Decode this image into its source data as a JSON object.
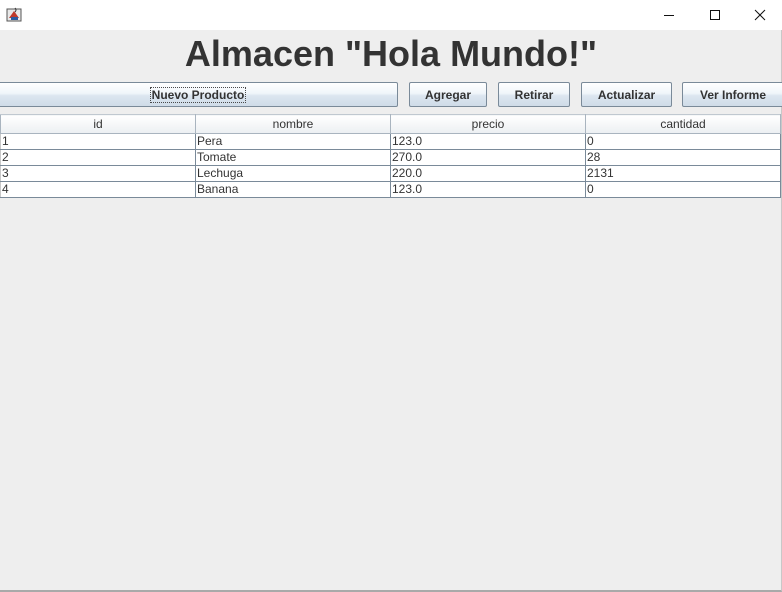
{
  "window": {
    "icon": "java-app-icon",
    "controls": {
      "minimize": "minimize-icon",
      "maximize": "maximize-icon",
      "close": "close-icon"
    }
  },
  "heading": "Almacen \"Hola Mundo!\"",
  "toolbar": {
    "nuevo_label": "Nuevo Producto",
    "agregar_label": "Agregar",
    "retirar_label": "Retirar",
    "actualizar_label": "Actualizar",
    "informe_label": "Ver Informe"
  },
  "table": {
    "columns": [
      "id",
      "nombre",
      "precio",
      "cantidad"
    ],
    "rows": [
      [
        "1",
        "Pera",
        "123.0",
        "0"
      ],
      [
        "2",
        "Tomate",
        "270.0",
        "28"
      ],
      [
        "3",
        "Lechuga",
        "220.0",
        "2131"
      ],
      [
        "4",
        "Banana",
        "123.0",
        "0"
      ]
    ]
  }
}
